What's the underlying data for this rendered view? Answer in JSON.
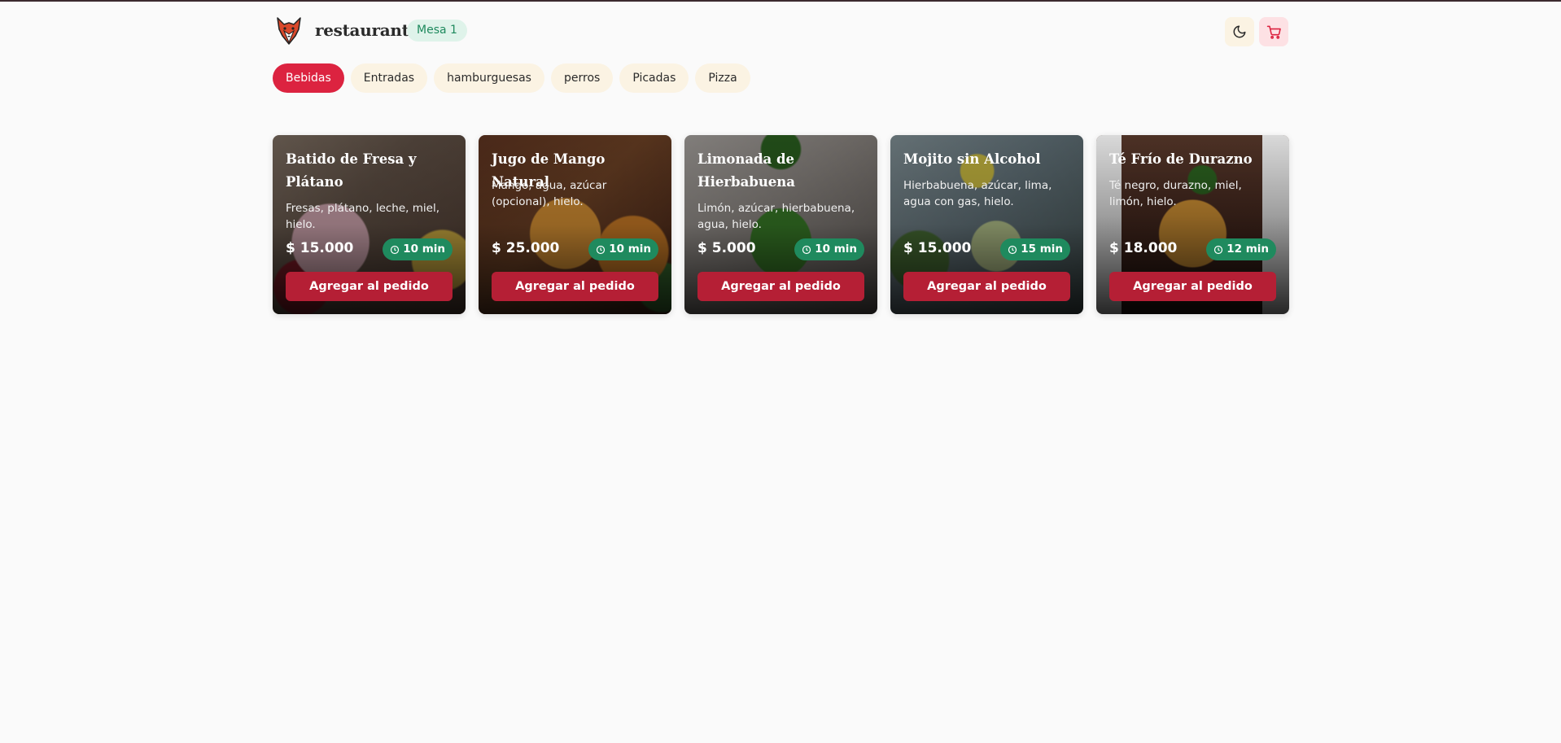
{
  "header": {
    "brand": "restaurant",
    "table_badge": "Mesa 1",
    "logo_icon": "fox-logo-icon",
    "theme_icon": "moon-icon",
    "cart_icon": "cart-icon"
  },
  "categories": [
    {
      "label": "Bebidas",
      "active": true
    },
    {
      "label": "Entradas",
      "active": false
    },
    {
      "label": "hamburguesas",
      "active": false
    },
    {
      "label": "perros",
      "active": false
    },
    {
      "label": "Picadas",
      "active": false
    },
    {
      "label": "Pizza",
      "active": false
    }
  ],
  "products": [
    {
      "title": "Batido de Fresa y Plátano",
      "description": "Fresas, plátano, leche, miel, hielo.",
      "price": "$ 15.000",
      "time": "10 min",
      "button": "Agregar al pedido"
    },
    {
      "title": "Jugo de Mango Natural",
      "description": "Mango, agua, azúcar (opcional), hielo.",
      "price": "$ 25.000",
      "time": "10 min",
      "button": "Agregar al pedido"
    },
    {
      "title": "Limonada de Hierbabuena",
      "description": "Limón, azúcar, hierbabuena, agua, hielo.",
      "price": "$ 5.000",
      "time": "10 min",
      "button": "Agregar al pedido"
    },
    {
      "title": "Mojito sin Alcohol",
      "description": "Hierbabuena, azúcar, lima, agua con gas, hielo.",
      "price": "$ 15.000",
      "time": "15 min",
      "button": "Agregar al pedido"
    },
    {
      "title": "Té Frío de Durazno",
      "description": "Té negro, durazno, miel, limón, hielo.",
      "price": "$ 18.000",
      "time": "12 min",
      "button": "Agregar al pedido"
    }
  ],
  "colors": {
    "primary": "#dc2340",
    "button": "#b51f35",
    "success": "#1f8a5e",
    "chip": "#fbf3e3"
  }
}
